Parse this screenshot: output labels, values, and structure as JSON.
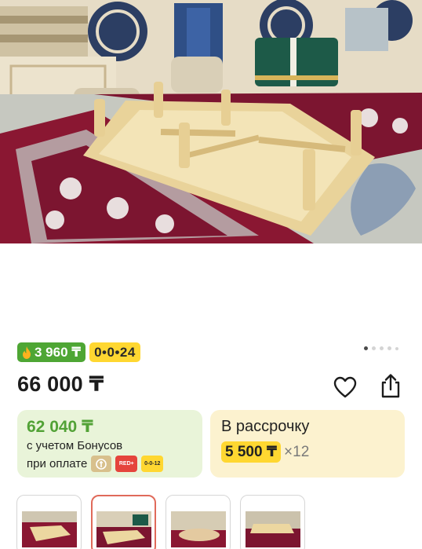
{
  "product": {
    "photo_alt": "Деревянный стол на ковре в юрте"
  },
  "badges": {
    "bonus_value": "3 960 ₸",
    "installment_label": "0•0•24"
  },
  "gallery": {
    "dots_total": 5,
    "active_index": 0
  },
  "price": {
    "current": "66 000 ₸"
  },
  "actions": {
    "favorite_icon": "heart-icon",
    "share_icon": "share-icon"
  },
  "bonus_card": {
    "price": "62 040 ₸",
    "note": "с учетом Бонусов",
    "pay_label": "при оплате",
    "logos": [
      "kaspi",
      "RED+",
      "0-0-12"
    ]
  },
  "installment_card": {
    "title": "В рассрочку",
    "amount": "5 500 ₸",
    "months": "×12"
  },
  "thumbnails": {
    "count": 4,
    "active_index": 1
  },
  "colors": {
    "bonus_green": "#4ea634",
    "installment_yellow": "#ffd731",
    "bonus_card_bg": "#e9f4d9",
    "installment_card_bg": "#fcf2cf",
    "thumb_active_border": "#e06a5a"
  }
}
